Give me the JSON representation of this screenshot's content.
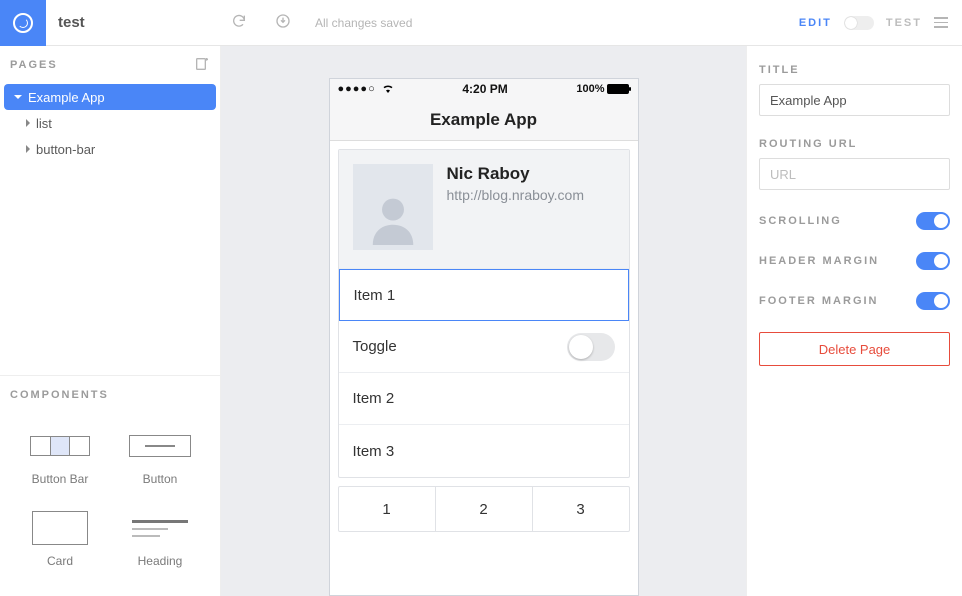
{
  "project": {
    "name": "test"
  },
  "topbar": {
    "status": "All changes saved",
    "mode_edit": "EDIT",
    "mode_test": "TEST"
  },
  "pages": {
    "header": "PAGES",
    "items": [
      {
        "label": "Example App",
        "selected": true
      },
      {
        "label": "list",
        "selected": false
      },
      {
        "label": "button-bar",
        "selected": false
      }
    ]
  },
  "components": {
    "header": "COMPONENTS",
    "items": [
      {
        "label": "Button Bar"
      },
      {
        "label": "Button"
      },
      {
        "label": "Card"
      },
      {
        "label": "Heading"
      }
    ]
  },
  "device": {
    "statusbar": {
      "signal": "●●●●○",
      "wifi": "wifi",
      "time": "4:20 PM",
      "battery": "100%"
    },
    "header_title": "Example App",
    "card": {
      "name": "Nic Raboy",
      "url": "http://blog.nraboy.com",
      "rows": [
        {
          "label": "Item 1",
          "type": "item",
          "selected": true
        },
        {
          "label": "Toggle",
          "type": "toggle",
          "on": false
        },
        {
          "label": "Item 2",
          "type": "item"
        },
        {
          "label": "Item 3",
          "type": "item"
        }
      ]
    },
    "buttonbar": [
      "1",
      "2",
      "3"
    ]
  },
  "inspector": {
    "title_label": "TITLE",
    "title_value": "Example App",
    "routing_label": "ROUTING URL",
    "routing_placeholder": "URL",
    "routing_value": "",
    "scrolling_label": "SCROLLING",
    "header_margin_label": "HEADER MARGIN",
    "footer_margin_label": "FOOTER MARGIN",
    "scrolling": true,
    "header_margin": true,
    "footer_margin": true,
    "delete_label": "Delete Page"
  }
}
